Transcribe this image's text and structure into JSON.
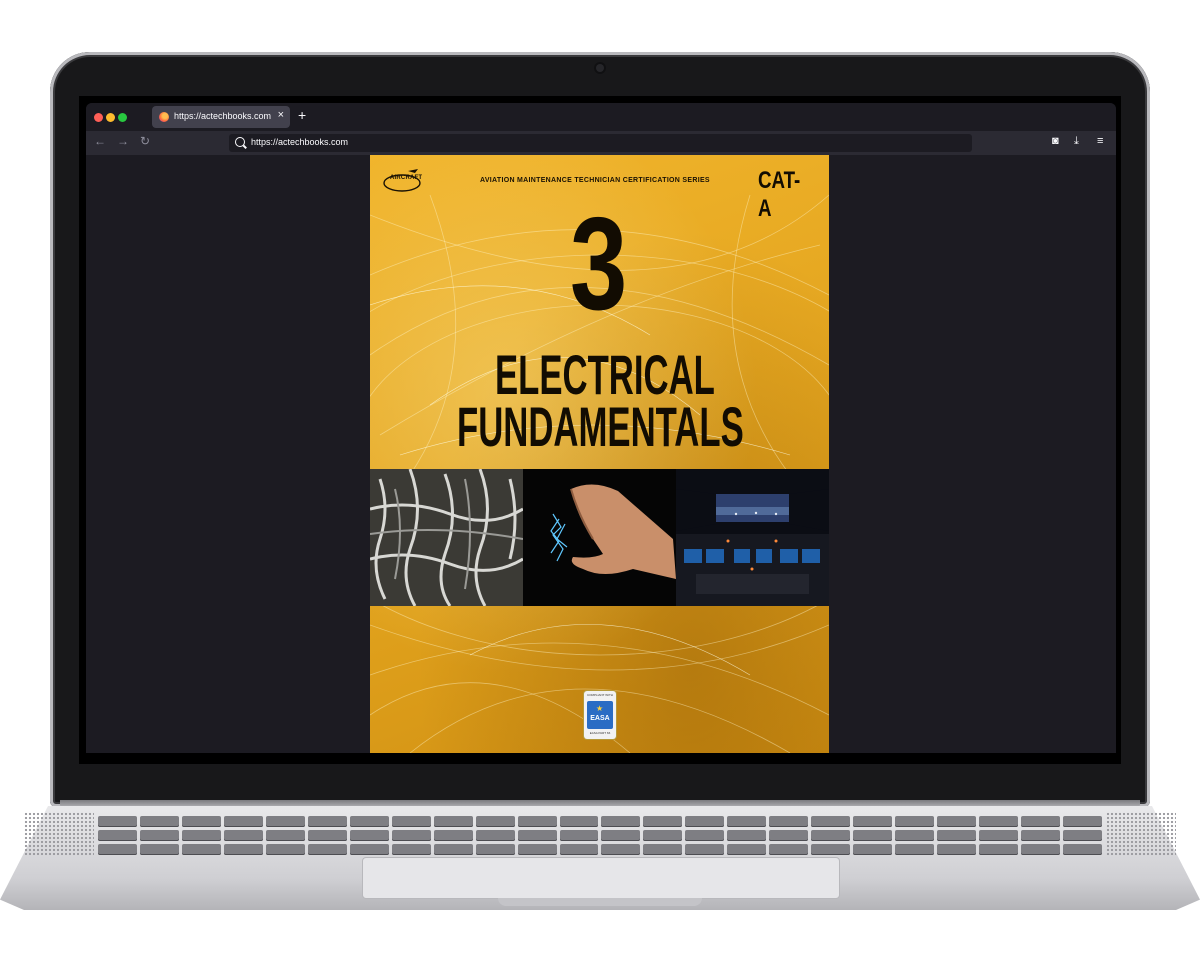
{
  "browser": {
    "tab_title": "https://actechbooks.com",
    "tab_close": "×",
    "new_tab": "+",
    "back": "←",
    "forward": "→",
    "reload": "↻",
    "url": "https://actechbooks.com",
    "pocket": "◙",
    "download": "⤓",
    "menu": "≡"
  },
  "cover": {
    "logo": "AIRCRAFT",
    "series": "AVIATION MAINTENANCE TECHNICIAN CERTIFICATION SERIES",
    "category": "CAT-A",
    "volume": "3",
    "title_line1": "ELECTRICAL",
    "title_line2": "FUNDAMENTALS",
    "easa_top": "COMPLIANT WITH",
    "easa_label": "EASA",
    "easa_bottom": "EASA PART 66",
    "accent_color": "#e8a923"
  }
}
